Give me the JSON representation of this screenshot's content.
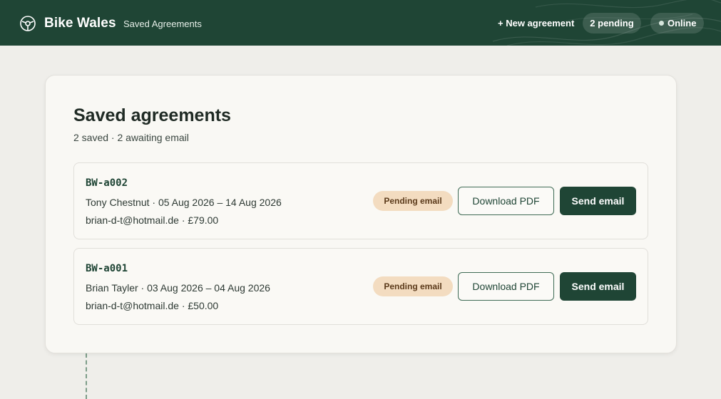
{
  "header": {
    "brand_name": "Bike Wales",
    "brand_subtitle": "Saved Agreements",
    "brand_icon": "steering-wheel-icon",
    "new_agreement_label": "+ New agreement",
    "pending_label": "2 pending",
    "online_label": "Online"
  },
  "main": {
    "title": "Saved agreements",
    "subtitle": "2 saved · 2 awaiting email",
    "agreements": [
      {
        "ref": "BW-a002",
        "details": "Tony Chestnut · 05 Aug 2026 – 14 Aug 2026",
        "contact": "brian-d-t@hotmail.de · £79.00",
        "status": "Pending email",
        "download_label": "Download PDF",
        "send_label": "Send email"
      },
      {
        "ref": "BW-a001",
        "details": "Brian Tayler · 03 Aug 2026 – 04 Aug 2026",
        "contact": "brian-d-t@hotmail.de · £50.00",
        "status": "Pending email",
        "download_label": "Download PDF",
        "send_label": "Send email"
      }
    ]
  },
  "colors": {
    "brand": "#1f4535",
    "background": "#efeeea",
    "badge_bg": "#f3dcc0",
    "badge_text": "#5b3a1a"
  }
}
